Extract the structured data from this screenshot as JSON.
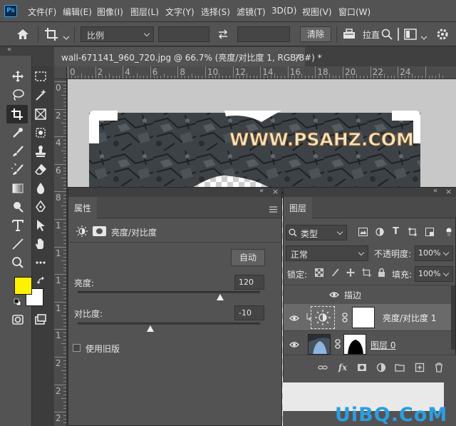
{
  "app": {
    "logo": "Ps"
  },
  "menu": [
    "文件(F)",
    "编辑(E)",
    "图像(I)",
    "图层(L)",
    "文字(Y)",
    "选择(S)",
    "滤镜(T)",
    "3D(D)",
    "视图(V)",
    "窗口(W)"
  ],
  "options": {
    "ratio_select": "比例",
    "clear_button": "清除",
    "straighten_label": "拉直"
  },
  "document": {
    "tab_title": "wall-671141_960_720.jpg @ 66.7% (亮度/对比度 1, RGB/8#) *",
    "ruler_top": [
      "0",
      "2",
      "4",
      "6",
      "8",
      "10",
      "12",
      "14",
      "16",
      "18",
      "20",
      "22",
      "24"
    ],
    "ruler_left": [
      "0",
      "2",
      "4",
      "6",
      "8",
      "1",
      "1",
      "1",
      "1",
      "1",
      "2",
      "2",
      "2"
    ],
    "canvas_text": "WWW.PSAHZ.COM"
  },
  "colors": {
    "foreground": "#fff200",
    "background": "#ffffff"
  },
  "properties": {
    "tab": "属性",
    "adjustment_title": "亮度/对比度",
    "auto_button": "自动",
    "brightness_label": "亮度:",
    "brightness_value": "120",
    "brightness_level": 0.78,
    "contrast_label": "对比度:",
    "contrast_value": "-10",
    "contrast_level": 0.4,
    "legacy_label": "使用旧版"
  },
  "layers": {
    "tab": "图层",
    "kind_filter": "类型",
    "blend_mode": "正常",
    "opacity_label": "不透明度:",
    "opacity_value": "100%",
    "lock_label": "锁定:",
    "fill_label": "填充:",
    "fill_value": "100%",
    "effect_name": "描边",
    "rows": [
      {
        "name": "亮度/对比度 1"
      },
      {
        "name": "图层 0"
      }
    ]
  },
  "watermark": "UiBQ.CoM"
}
